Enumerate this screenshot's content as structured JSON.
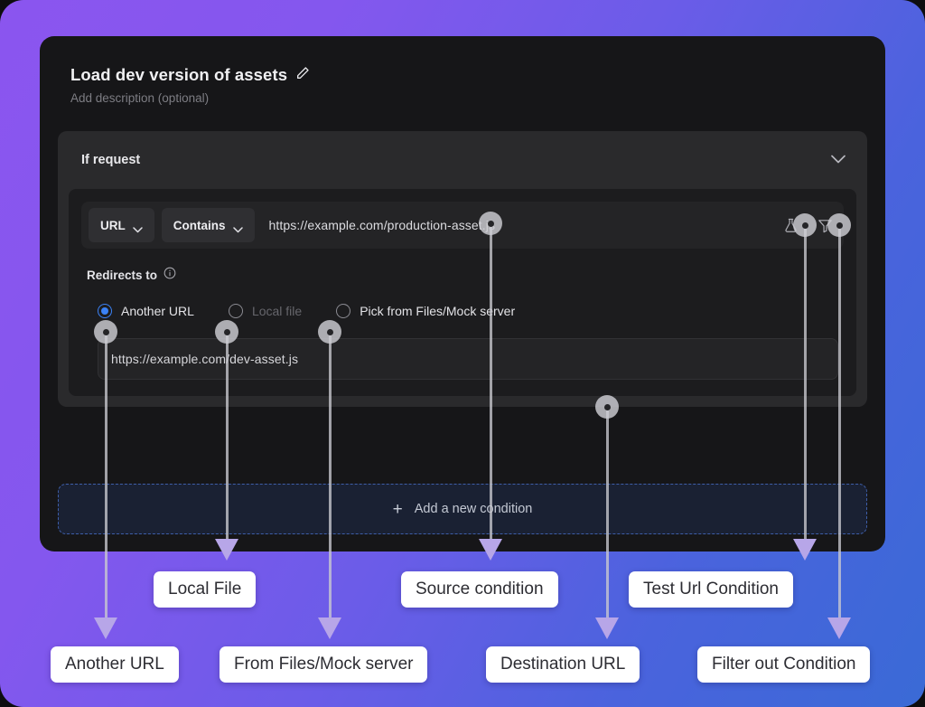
{
  "background": {
    "gradient_from": "#8b55ef",
    "gradient_to": "#3a6ad6"
  },
  "panel": {
    "title": "Load dev version of assets",
    "edit_icon": "pencil-icon",
    "description_placeholder": "Add description (optional)",
    "background": "#161618"
  },
  "condition_group": {
    "header_label": "If request",
    "collapse_icon": "chevron-down-icon",
    "condition": {
      "target_select": {
        "value": "URL",
        "icon": "chevron-down-icon"
      },
      "operator_select": {
        "value": "Contains",
        "icon": "chevron-down-icon"
      },
      "url_value": "https://example.com/production-asset.js",
      "actions": [
        {
          "name": "test-url-condition-button",
          "icon": "flask-icon"
        },
        {
          "name": "filter-out-condition-button",
          "icon": "funnel-icon"
        }
      ]
    },
    "redirects": {
      "label": "Redirects to",
      "info_icon": "info-icon",
      "options": [
        {
          "label": "Another URL",
          "selected": true,
          "disabled": false
        },
        {
          "label": "Local file",
          "selected": false,
          "disabled": true
        },
        {
          "label": "Pick from Files/Mock server",
          "selected": false,
          "disabled": false
        }
      ],
      "destination_url": "https://example.com/dev-asset.js"
    }
  },
  "add_condition": {
    "label": "Add a new condition",
    "plus_icon": "plus-icon",
    "border_color": "#3e5ea8"
  },
  "annotations": {
    "arrow_color": "#b7a6e8",
    "labels": [
      {
        "id": "another-url",
        "text": "Another URL"
      },
      {
        "id": "local-file",
        "text": "Local File"
      },
      {
        "id": "files-mock-server",
        "text": "From Files/Mock server"
      },
      {
        "id": "source-condition",
        "text": "Source condition"
      },
      {
        "id": "destination-url",
        "text": "Destination URL"
      },
      {
        "id": "test-url-condition",
        "text": "Test Url Condition"
      },
      {
        "id": "filter-out-condition",
        "text": "Filter out Condition"
      }
    ]
  }
}
